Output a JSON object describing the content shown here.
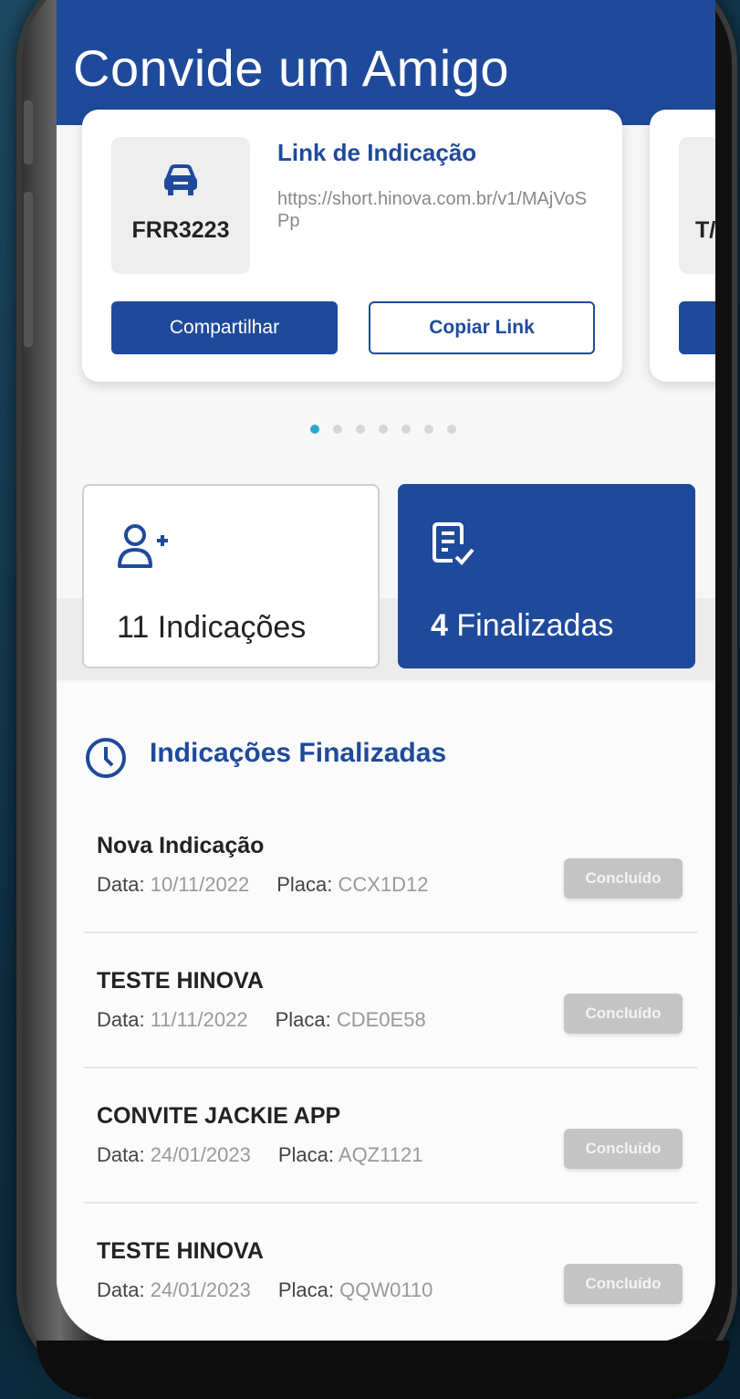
{
  "header": {
    "title": "Convide um Amigo"
  },
  "referral_card": {
    "plate": "FRR3223",
    "link_title": "Link de Indicação",
    "link_url": "https://short.hinova.com.br/v1/MAjVoSPp",
    "share_label": "Compartilhar",
    "copy_label": "Copiar Link"
  },
  "next_card": {
    "plate_partial": "T/"
  },
  "carousel": {
    "page_count": 7,
    "active_page": 1
  },
  "stats": {
    "indications": {
      "count": "11",
      "label": "Indicações"
    },
    "finalized": {
      "count": "4",
      "label": "Finalizadas"
    }
  },
  "list": {
    "title": "Indicações Finalizadas",
    "date_label": "Data:",
    "plate_label": "Placa:",
    "items": [
      {
        "name": "Nova Indicação",
        "date": "10/11/2022",
        "plate": "CCX1D12",
        "status": "Concluído"
      },
      {
        "name": "TESTE HINOVA",
        "date": "11/11/2022",
        "plate": "CDE0E58",
        "status": "Concluído"
      },
      {
        "name": "CONVITE JACKIE APP",
        "date": "24/01/2023",
        "plate": "AQZ1121",
        "status": "Concluído"
      },
      {
        "name": "TESTE HINOVA",
        "date": "24/01/2023",
        "plate": "QQW0110",
        "status": "Concluído"
      }
    ]
  },
  "colors": {
    "primary": "#1f4a9b",
    "dot_active": "#2aa9d0",
    "badge_bg": "#c4c4c4"
  },
  "icons": [
    "car-icon",
    "add-user-icon",
    "document-check-icon",
    "clock-icon"
  ]
}
